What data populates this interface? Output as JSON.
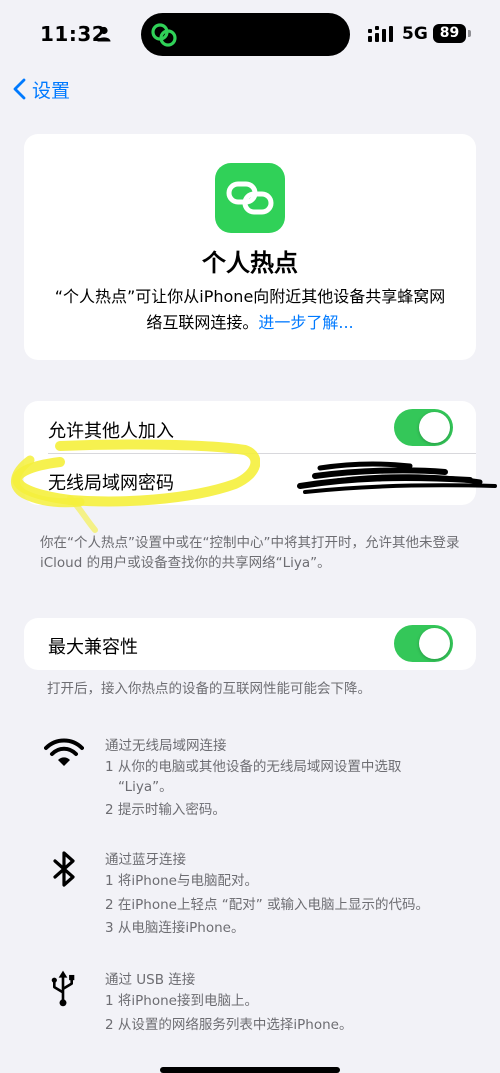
{
  "status_bar": {
    "time": "11:32",
    "network": "5G",
    "battery": "89"
  },
  "nav": {
    "back_label": "设置"
  },
  "hero": {
    "icon": "hotspot-link-icon",
    "title": "个人热点",
    "description": "“个人热点”可让你从iPhone向附近其他设备共享蜂窝网络互联网连接。",
    "learn_more": "进一步了解..."
  },
  "settings": {
    "allow_others_label": "允许其他人加入",
    "allow_others_on": true,
    "wifi_password_label": "无线局域网密码",
    "footnote": "你在“个人热点”设置中或在“控制中心”中将其打开时，允许其他未登录 iCloud 的用户或设备查找你的共享网络“Liya”。",
    "max_compat_label": "最大兼容性",
    "max_compat_on": true,
    "max_compat_footnote": "打开后，接入你热点的设备的互联网性能可能会下降。"
  },
  "methods": {
    "wifi": {
      "icon": "wifi-icon",
      "title": "通过无线局域网连接",
      "step1": "1 从你的电脑或其他设备的无线局域网设置中选取",
      "step1b": "“Liya”。",
      "step2": "2 提示时输入密码。"
    },
    "bluetooth": {
      "icon": "bluetooth-icon",
      "title": "通过蓝牙连接",
      "step1": "1 将iPhone与电脑配对。",
      "step2": "2 在iPhone上轻点 “配对” 或输入电脑上显示的代码。",
      "step3": "3 从电脑连接iPhone。"
    },
    "usb": {
      "icon": "usb-icon",
      "title": "通过 USB 连接",
      "step1": "1 将iPhone接到电脑上。",
      "step2": "2 从设置的网络服务列表中选择iPhone。"
    }
  },
  "colors": {
    "accent": "#007aff",
    "toggle_on": "#34c759",
    "hotspot_green": "#30d158",
    "highlight": "#f5f03c"
  }
}
